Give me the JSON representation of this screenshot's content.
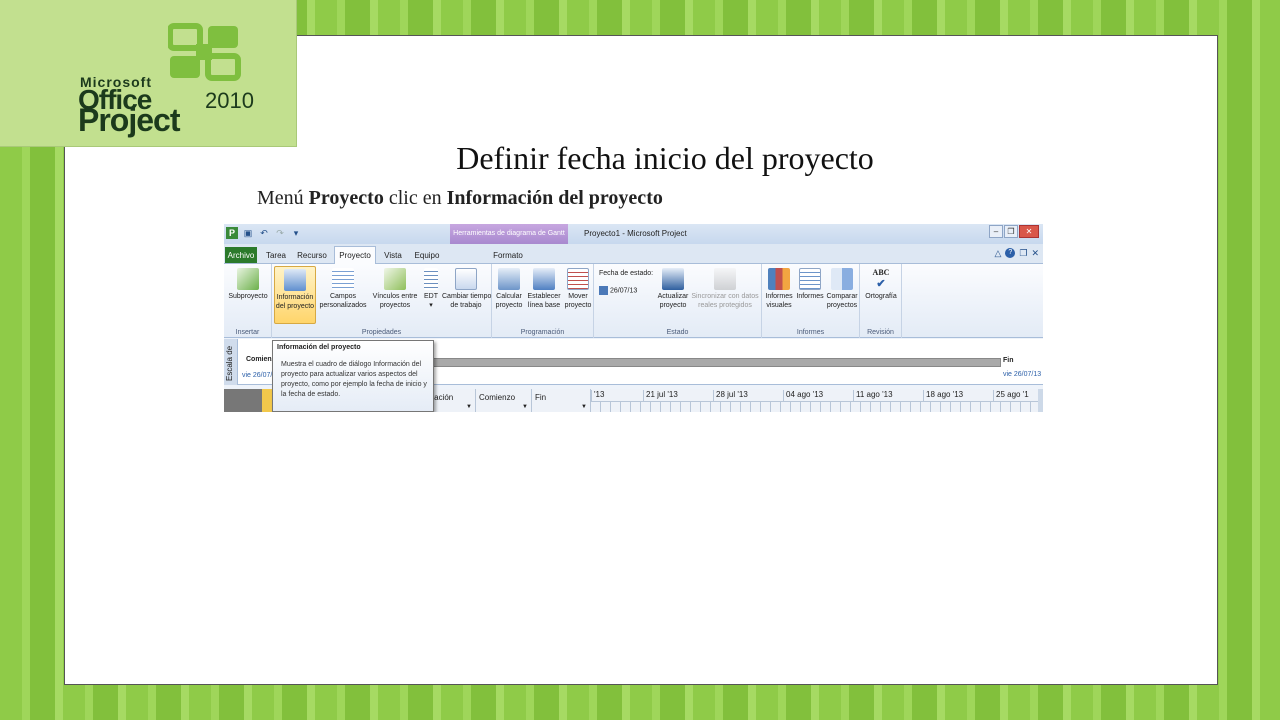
{
  "logo": {
    "microsoft": "Microsoft",
    "office": "Office",
    "year": "2010",
    "project": "Project",
    "brand_color": "#1c3a1c",
    "icon_color": "#7fbf3f"
  },
  "slide": {
    "title": "Definir fecha inicio del proyecto",
    "subtitle_prefix": "Menú ",
    "subtitle_bold1": "Proyecto",
    "subtitle_mid": " clic en ",
    "subtitle_bold2": "Información del proyecto"
  },
  "app": {
    "context_tab": "Herramientas de diagrama de Gantt",
    "window_title": "Proyecto1 - Microsoft Project",
    "tabs": [
      {
        "label": "Archivo"
      },
      {
        "label": "Tarea"
      },
      {
        "label": "Recurso"
      },
      {
        "label": "Proyecto"
      },
      {
        "label": "Vista"
      },
      {
        "label": "Equipo"
      },
      {
        "label": "Formato"
      }
    ],
    "ribbon": {
      "insertar": {
        "label": "Insertar",
        "subproyecto": "Subproyecto"
      },
      "propiedades": {
        "label": "Propiedades",
        "info_l1": "Información",
        "info_l2": "del proyecto",
        "campos_l1": "Campos",
        "campos_l2": "personalizados",
        "vinculos_l1": "Vínculos entre",
        "vinculos_l2": "proyectos",
        "edt": "EDT",
        "cambiar_l1": "Cambiar tiempo",
        "cambiar_l2": "de trabajo"
      },
      "programacion": {
        "label": "Programación",
        "calcular_l1": "Calcular",
        "calcular_l2": "proyecto",
        "establecer_l1": "Establecer",
        "establecer_l2": "línea base",
        "mover_l1": "Mover",
        "mover_l2": "proyecto"
      },
      "estado": {
        "label": "Estado",
        "fecha_label": "Fecha de estado:",
        "fecha_value": "26/07/13",
        "actualizar_l1": "Actualizar",
        "actualizar_l2": "proyecto",
        "sincronizar_l1": "Sincronizar con datos",
        "sincronizar_l2": "reales protegidos"
      },
      "informes": {
        "label": "Informes",
        "visuales_l1": "Informes",
        "visuales_l2": "visuales",
        "informes": "Informes",
        "comparar_l1": "Comparar",
        "comparar_l2": "proyectos"
      },
      "revision": {
        "label": "Revisión",
        "ortografia": "Ortografía",
        "abc": "ABC"
      }
    },
    "timeline": {
      "escala": "Escala de",
      "comienzo": "Comienzo",
      "comienzo_date": "vie 26/07/13",
      "fin": "Fin",
      "fin_date": "vie 26/07/13"
    },
    "grid": {
      "col_duracion": "uración",
      "col_comienzo": "Comienzo",
      "col_fin": "Fin",
      "weeks": [
        "'13",
        "21 jul '13",
        "28 jul '13",
        "04 ago '13",
        "11 ago '13",
        "18 ago '13",
        "25 ago '1"
      ]
    },
    "tooltip": {
      "title": "Información del proyecto",
      "body": "Muestra el cuadro de diálogo Información del proyecto para actualizar varios aspectos del proyecto, como por ejemplo la fecha de inicio y la fecha de estado."
    }
  }
}
